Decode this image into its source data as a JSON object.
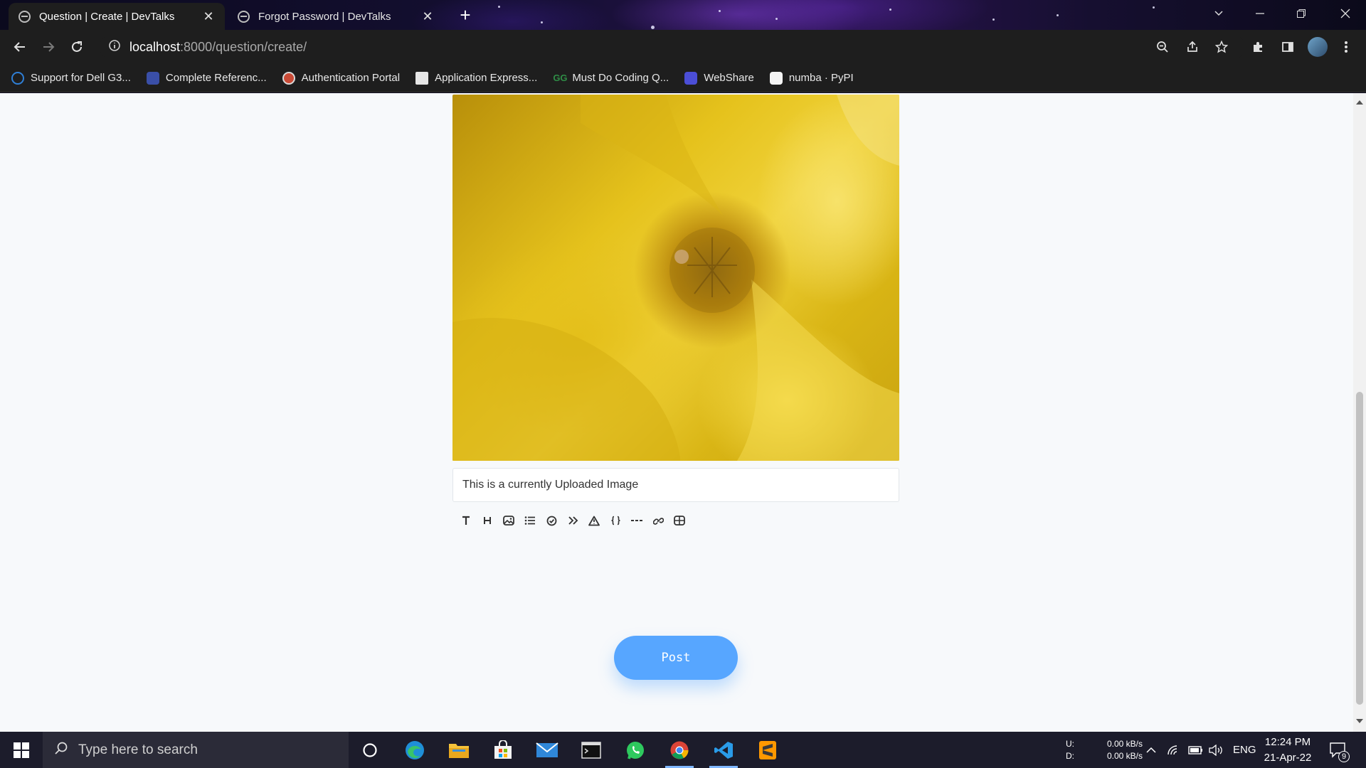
{
  "browser": {
    "tabs": [
      {
        "title": "Question | Create | DevTalks",
        "active": true
      },
      {
        "title": "Forgot Password | DevTalks",
        "active": false
      }
    ],
    "new_tab_label": "+",
    "url_host": "localhost",
    "url_path": ":8000/question/create/",
    "bookmarks": [
      {
        "label": "Support for Dell G3...",
        "icon": "dell-icon",
        "color": "#2f7fd6"
      },
      {
        "label": "Complete Referenc...",
        "icon": "book-icon",
        "color": "#3a4fa8"
      },
      {
        "label": "Authentication Portal",
        "icon": "portal-icon",
        "color": "#c94a36"
      },
      {
        "label": "Application Express...",
        "icon": "folder-icon",
        "color": "#e6e6e6"
      },
      {
        "label": "Must Do Coding Q...",
        "icon": "gfg-icon",
        "color": "#2f8d46"
      },
      {
        "label": "WebShare",
        "icon": "webshare-icon",
        "color": "#4b4ed6"
      },
      {
        "label": "numba · PyPI",
        "icon": "pypi-icon",
        "color": "#f4f4f4"
      }
    ]
  },
  "page": {
    "image_caption": "This is a currently Uploaded Image",
    "editor_tools": [
      {
        "name": "text-tool-icon",
        "glyph": "T"
      },
      {
        "name": "heading-tool-icon",
        "glyph": "H"
      },
      {
        "name": "image-tool-icon",
        "glyph": "img"
      },
      {
        "name": "list-tool-icon",
        "glyph": "list"
      },
      {
        "name": "checklist-tool-icon",
        "glyph": "check"
      },
      {
        "name": "quote-tool-icon",
        "glyph": "»"
      },
      {
        "name": "warning-tool-icon",
        "glyph": "warn"
      },
      {
        "name": "code-tool-icon",
        "glyph": "{}"
      },
      {
        "name": "delimiter-tool-icon",
        "glyph": "---"
      },
      {
        "name": "link-tool-icon",
        "glyph": "link"
      },
      {
        "name": "table-tool-icon",
        "glyph": "table"
      }
    ],
    "post_button": "Post"
  },
  "taskbar": {
    "search_placeholder": "Type here to search",
    "upload_label": "U:",
    "download_label": "D:",
    "upload_speed": "0.00 kB/s",
    "download_speed": "0.00 kB/s",
    "language": "ENG",
    "time": "12:24 PM",
    "date": "21-Apr-22",
    "notification_count": "9"
  },
  "colors": {
    "post_button": "#57a6ff",
    "page_background": "#f7f9fb",
    "chrome_background": "#1e1e1e"
  }
}
